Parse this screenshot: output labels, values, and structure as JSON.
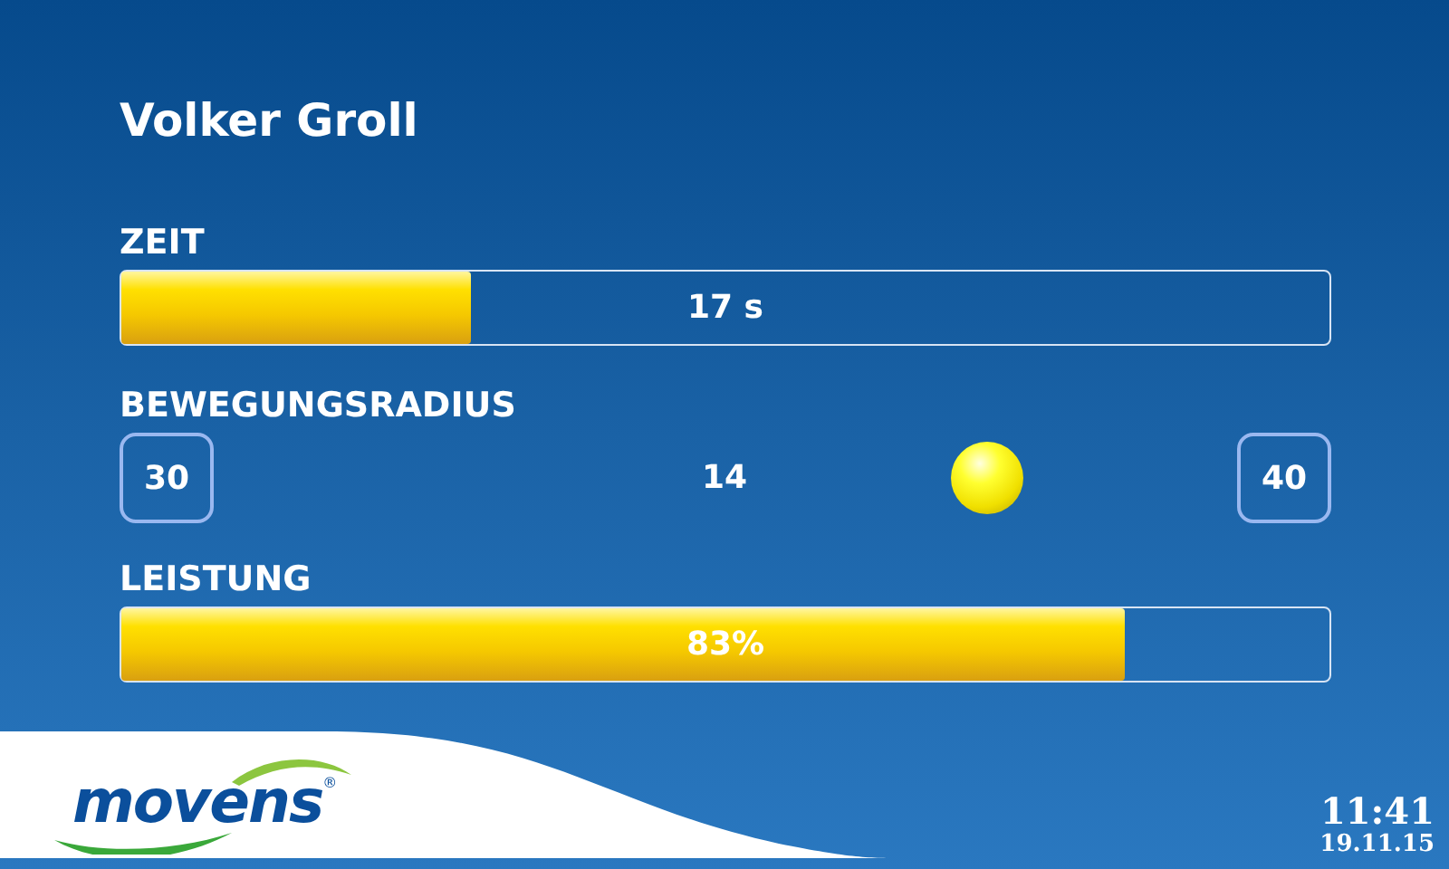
{
  "title": "Volker Groll",
  "time_meter": {
    "label": "ZEIT",
    "level": 0.29,
    "reading": "17 s"
  },
  "radius": {
    "label": "BEWEGUNGSRADIUS",
    "min": "30",
    "value": "14",
    "max": "40"
  },
  "performance_meter": {
    "label": "LEISTUNG",
    "level": 0.83,
    "reading": "83%"
  },
  "logo": {
    "text": "movens",
    "mark": "®"
  },
  "clock": {
    "time": "11:41",
    "date": "19.11.15"
  }
}
